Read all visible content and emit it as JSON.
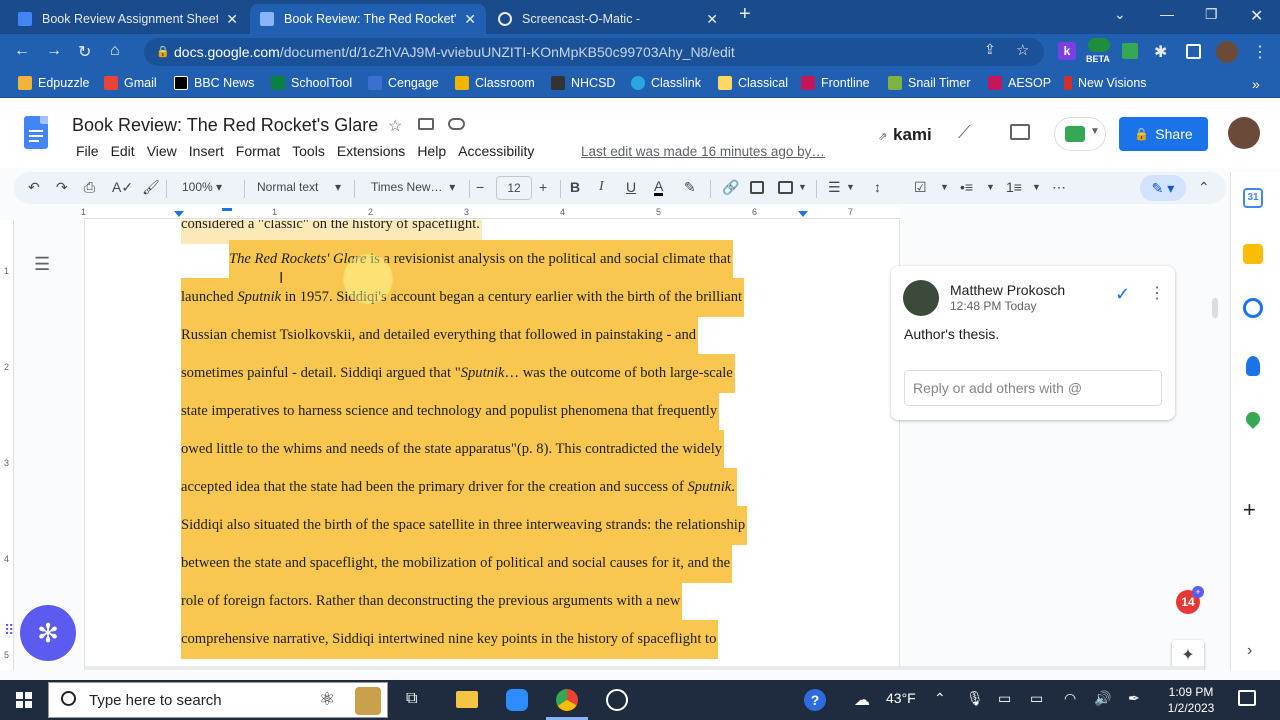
{
  "browser": {
    "tabs": [
      {
        "title": "Book Review Assignment Sheet -",
        "favicon_color": "#4285f4",
        "active": false
      },
      {
        "title": "Book Review: The Red Rocket's G",
        "favicon_color": "#4285f4",
        "active": true
      },
      {
        "title": "Screencast-O-Matic -",
        "favicon_color": "#e8eaed",
        "active": false
      }
    ],
    "new_tab": "+",
    "url_host": "docs.google.com",
    "url_path": "/document/d/1cZhVAJ9M-vviebuUNZITI-KOnMpKB50c99703Ahy_N8/edit",
    "beta_label": "BETA",
    "bookmarks": [
      {
        "label": "Edpuzzle",
        "color": "#f2b33d"
      },
      {
        "label": "Gmail",
        "color": "#ea4335"
      },
      {
        "label": "BBC News",
        "color": "#000000"
      },
      {
        "label": "SchoolTool",
        "color": "#0b8043"
      },
      {
        "label": "Cengage",
        "color": "#3c6fcf"
      },
      {
        "label": "Classroom",
        "color": "#f4b400"
      },
      {
        "label": "NHCSD",
        "color": "#333333"
      },
      {
        "label": "Classlink",
        "color": "#29a8e0"
      },
      {
        "label": "Classical",
        "color": "#fdd663"
      },
      {
        "label": "Frontline",
        "color": "#c2185b"
      },
      {
        "label": "Snail Timer",
        "color": "#7cb342"
      },
      {
        "label": "AESOP",
        "color": "#c2185b"
      },
      {
        "label": "New Visions",
        "color": "#d32f2f"
      }
    ],
    "bookmarks_more": "»"
  },
  "doc": {
    "title": "Book Review: The Red Rocket's Glare",
    "menus": [
      "File",
      "Edit",
      "View",
      "Insert",
      "Format",
      "Tools",
      "Extensions",
      "Help",
      "Accessibility"
    ],
    "last_edit": "Last edit was made 16 minutes ago by…",
    "kami": "kami",
    "share": "Share"
  },
  "toolbar": {
    "zoom": "100%",
    "style": "Normal text",
    "font": "Times New…",
    "font_size": "12",
    "minus": "−",
    "plus": "+",
    "bold": "B",
    "italic": "I",
    "underline": "U",
    "textcolor": "A"
  },
  "ruler": {
    "h": [
      "1",
      "1",
      "2",
      "3",
      "4",
      "5",
      "6",
      "7"
    ],
    "v": [
      "1",
      "2",
      "3",
      "4",
      "5"
    ]
  },
  "body": {
    "lines": [
      {
        "parts": [
          {
            "t": "considered a \"classic\" on the history of spaceflight.",
            "i": false
          }
        ],
        "faint": true
      },
      {
        "parts": [
          {
            "t": "The Red Rockets' Glare",
            "i": true
          },
          {
            "t": " is a revisionist analysis on the political and social climate that",
            "i": false
          }
        ],
        "indent": true
      },
      {
        "parts": [
          {
            "t": "launched ",
            "i": false
          },
          {
            "t": "Sputnik",
            "i": true
          },
          {
            "t": " in 1957. Siddiqi's account began a century earlier with the birth of the brilliant",
            "i": false
          }
        ]
      },
      {
        "parts": [
          {
            "t": "Russian chemist Tsiolkovskii, and detailed everything that followed in painstaking - and",
            "i": false
          }
        ]
      },
      {
        "parts": [
          {
            "t": "sometimes painful - detail. Siddiqi argued that \"",
            "i": false
          },
          {
            "t": "Sputnik",
            "i": true
          },
          {
            "t": "… was the outcome of both large-scale",
            "i": false
          }
        ]
      },
      {
        "parts": [
          {
            "t": "state imperatives to harness science and technology and populist phenomena that frequently",
            "i": false
          }
        ]
      },
      {
        "parts": [
          {
            "t": "owed little to the whims and needs of the state apparatus\"(p. 8). This contradicted the widely",
            "i": false
          }
        ]
      },
      {
        "parts": [
          {
            "t": "accepted idea that the state had been the primary driver for the creation and success of ",
            "i": false
          },
          {
            "t": "Sputnik",
            "i": true
          },
          {
            "t": ".",
            "i": false
          }
        ]
      },
      {
        "parts": [
          {
            "t": "Siddiqi also situated the birth of the space satellite in three interweaving strands: the relationship",
            "i": false
          }
        ]
      },
      {
        "parts": [
          {
            "t": "between the state and spaceflight, the mobilization of political and social causes for it, and the",
            "i": false
          }
        ]
      },
      {
        "parts": [
          {
            "t": "role of foreign factors. Rather than deconstructing the previous arguments with a new",
            "i": false
          }
        ]
      },
      {
        "parts": [
          {
            "t": "comprehensive narrative, Siddiqi intertwined nine key points in the history of spaceflight to",
            "i": false
          }
        ]
      }
    ]
  },
  "comment": {
    "author": "Matthew Prokosch",
    "time": "12:48 PM Today",
    "text": "Author's thesis.",
    "reply_placeholder": "Reply or add others with @"
  },
  "badge": "14",
  "taskbar": {
    "search_placeholder": "Type here to search",
    "weather": "43°F",
    "time": "1:09 PM",
    "date": "1/2/2023"
  },
  "colors": {
    "highlight": "#f9c74f",
    "share": "#1a73e8",
    "chrome_frame": "#1a4b8c"
  }
}
